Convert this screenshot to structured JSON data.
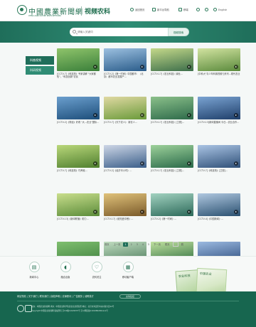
{
  "header": {
    "logo_cn": "中國農業新聞網",
    "logo_en": "CHINA AGRICULTURE NEWS NETWORK",
    "site_name": "视频农科",
    "nav": [
      {
        "label": "返回首页"
      },
      {
        "label": "新平台导航"
      },
      {
        "label": "移端"
      },
      {
        "label": "English"
      }
    ]
  },
  "search": {
    "placeholder": "请输入关键词",
    "button_label": "视频搜索"
  },
  "sidebar": {
    "items": [
      {
        "label": "科普视频"
      },
      {
        "label": "科研视频"
      }
    ]
  },
  "videos": [
    {
      "title": "[CCTV-7]《科技苑》专家讲解 \"大家都知\"，\"科技创新\"农民"
    },
    {
      "title": "[CCTV-2]《第一时间》中国都市：（北京）都市农业发展产..."
    },
    {
      "title": "[CCTV-17]《农业科技》绿色..."
    },
    {
      "title": "[中科大\"青少年科普视频\"]系列...现代农业"
    },
    {
      "title": "[CCTV-2]《财经》好看 \"大...农业\"国际..."
    },
    {
      "title": "[CCTV-7]《天下农人》 新农人..."
    },
    {
      "title": "[CCTV-17]《农业科技》[卫视]..."
    },
    {
      "title": "[CCTV-13]新闻直播间 今日...农业合作..."
    },
    {
      "title": "[CCTV-7]《科技苑》巧养殖..."
    },
    {
      "title": "[CCTV-2]《经济半小时》..."
    },
    {
      "title": "[CCTV-17]《农业科技》[卫视]..."
    },
    {
      "title": "[CCTV-7]《科技苑》[卫视]..."
    },
    {
      "title": "[CCTV-13]《新闻联播》助力..."
    },
    {
      "title": "[CCTV-17]《谁知盘中餐》..."
    },
    {
      "title": "[CCTV-2]《第一时间》..."
    },
    {
      "title": "[CCTV-4]《中国新闻》..."
    },
    {
      "title": "[CCTV-13]新闻直播间..."
    },
    {
      "title": "[CCTV-17]《田间示范秀》..."
    },
    {
      "title": "[CCTV-7]《科技苑》..."
    },
    {
      "title": "[CCTV-2]《第一时间》..."
    },
    {
      "title": "[CCTV-17]《致富经》..."
    },
    {
      "title": "[CCTV-2]《第一时间》专家..."
    },
    {
      "title": "[CCTV-17]《新闻联播》..."
    },
    {
      "title": "[CCTV-7]《乡村大世界》..."
    }
  ],
  "pagination": {
    "first": "首页",
    "prev": "上一页",
    "pages": [
      "1",
      "2",
      "3",
      "4",
      "5"
    ],
    "next": "下一页",
    "last": "尾页",
    "goto": "跳"
  },
  "footer": {
    "icons": [
      {
        "label": "新闻中心"
      },
      {
        "label": "融合出版"
      },
      {
        "label": "农科关注"
      },
      {
        "label": "移动客户端"
      }
    ],
    "books": [
      "农业科技",
      "中国农业"
    ],
    "links": "网站导航 | 关于我们 | 联系我们 | 版权声明 | 法律顾问 | 广告服务 | 诚聘英才",
    "links_select": "友情链接",
    "lines": [
      "主办：中国农业新闻网  承办：中国农业科学院农业信息研究所  地址：北京市海淀区中关村南大街12号",
      "Copyright 中国农业新闻网 版权所有  京ICP备11029337号  京公网安备1101080200xxxx号"
    ]
  }
}
